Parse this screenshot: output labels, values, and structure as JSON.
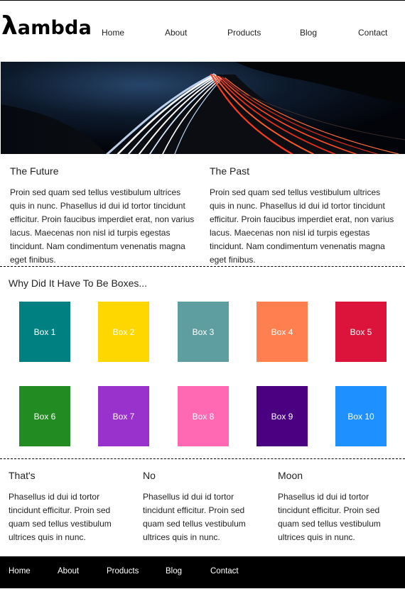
{
  "logo": {
    "symbol": "λ",
    "text": "ambda"
  },
  "nav": [
    "Home",
    "About",
    "Products",
    "Blog",
    "Contact"
  ],
  "hero": {
    "image": "highway-light-trails-at-night"
  },
  "top_columns": [
    {
      "title": "The Future",
      "text": "Proin sed quam sed tellus vestibulum ultrices quis in nunc. Phasellus id dui id tortor tincidunt efficitur. Proin faucibus imperdiet erat, non varius lacus. Maecenas non nisl id turpis egestas tincidunt. Nam condimentum venenatis magna eget finibus."
    },
    {
      "title": "The Past",
      "text": "Proin sed quam sed tellus vestibulum ultrices quis in nunc. Phasellus id dui id tortor tincidunt efficitur. Proin faucibus imperdiet erat, non varius lacus. Maecenas non nisl id turpis egestas tincidunt. Nam condimentum venenatis magna eget finibus."
    }
  ],
  "boxes_section": {
    "title": "Why Did It Have To Be Boxes..."
  },
  "boxes": [
    {
      "label": "Box 1",
      "color": "#008080"
    },
    {
      "label": "Box 2",
      "color": "#FFD700"
    },
    {
      "label": "Box 3",
      "color": "#5F9EA0"
    },
    {
      "label": "Box 4",
      "color": "#FF7F50"
    },
    {
      "label": "Box 5",
      "color": "#DC143C"
    },
    {
      "label": "Box 6",
      "color": "#228B22"
    },
    {
      "label": "Box 7",
      "color": "#9932CC"
    },
    {
      "label": "Box 8",
      "color": "#FF69B4"
    },
    {
      "label": "Box 9",
      "color": "#4B0082"
    },
    {
      "label": "Box 10",
      "color": "#1E90FF"
    }
  ],
  "bottom_columns": [
    {
      "title": "That's",
      "text": "Phasellus id dui id tortor tincidunt efficitur. Proin sed quam sed tellus vestibulum ultrices quis in nunc."
    },
    {
      "title": "No",
      "text": "Phasellus id dui id tortor tincidunt efficitur. Proin sed quam sed tellus vestibulum ultrices quis in nunc."
    },
    {
      "title": "Moon",
      "text": "Phasellus id dui id tortor tincidunt efficitur. Proin sed quam sed tellus vestibulum ultrices quis in nunc."
    }
  ],
  "footer_nav": [
    "Home",
    "About",
    "Products",
    "Blog",
    "Contact"
  ],
  "colors": {
    "footer_bg": "#000000",
    "text": "#222222"
  }
}
